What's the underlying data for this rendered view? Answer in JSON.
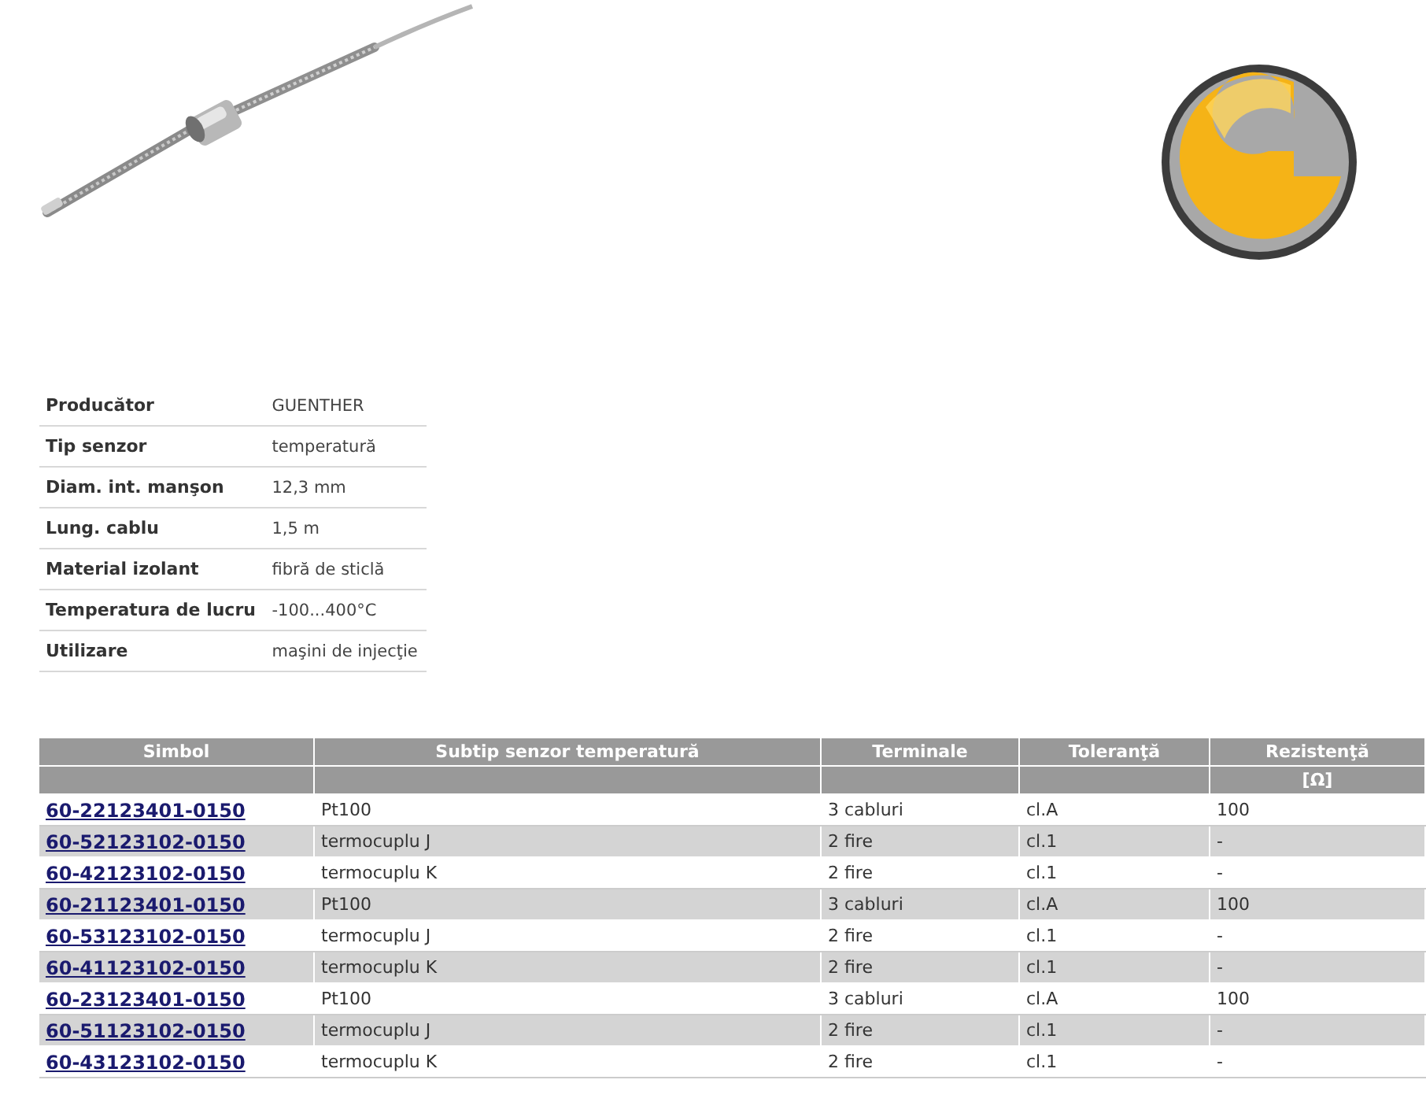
{
  "specs": [
    {
      "label": "Producător",
      "value": "GUENTHER"
    },
    {
      "label": "Tip senzor",
      "value": "temperatură"
    },
    {
      "label": "Diam. int. manşon",
      "value": "12,3 mm"
    },
    {
      "label": "Lung. cablu",
      "value": "1,5 m"
    },
    {
      "label": "Material izolant",
      "value": "fibră de sticlă"
    },
    {
      "label": "Temperatura de lucru",
      "value": "-100...400°C"
    },
    {
      "label": "Utilizare",
      "value": "maşini de injecţie"
    }
  ],
  "table": {
    "columns": [
      {
        "label": "Simbol"
      },
      {
        "label": "Subtip senzor temperatură"
      },
      {
        "label": "Terminale"
      },
      {
        "label": "Toleranţă"
      },
      {
        "label": "Rezistenţă",
        "unit": "[Ω]"
      }
    ],
    "rows": [
      [
        "60-22123401-0150",
        "Pt100",
        "3 cabluri",
        "cl.A",
        "100"
      ],
      [
        "60-52123102-0150",
        "termocuplu J",
        "2 fire",
        "cl.1",
        "-"
      ],
      [
        "60-42123102-0150",
        "termocuplu K",
        "2 fire",
        "cl.1",
        "-"
      ],
      [
        "60-21123401-0150",
        "Pt100",
        "3 cabluri",
        "cl.A",
        "100"
      ],
      [
        "60-53123102-0150",
        "termocuplu J",
        "2 fire",
        "cl.1",
        "-"
      ],
      [
        "60-41123102-0150",
        "termocuplu K",
        "2 fire",
        "cl.1",
        "-"
      ],
      [
        "60-23123401-0150",
        "Pt100",
        "3 cabluri",
        "cl.A",
        "100"
      ],
      [
        "60-51123102-0150",
        "termocuplu J",
        "2 fire",
        "cl.1",
        "-"
      ],
      [
        "60-43123102-0150",
        "termocuplu K",
        "2 fire",
        "cl.1",
        "-"
      ]
    ]
  }
}
